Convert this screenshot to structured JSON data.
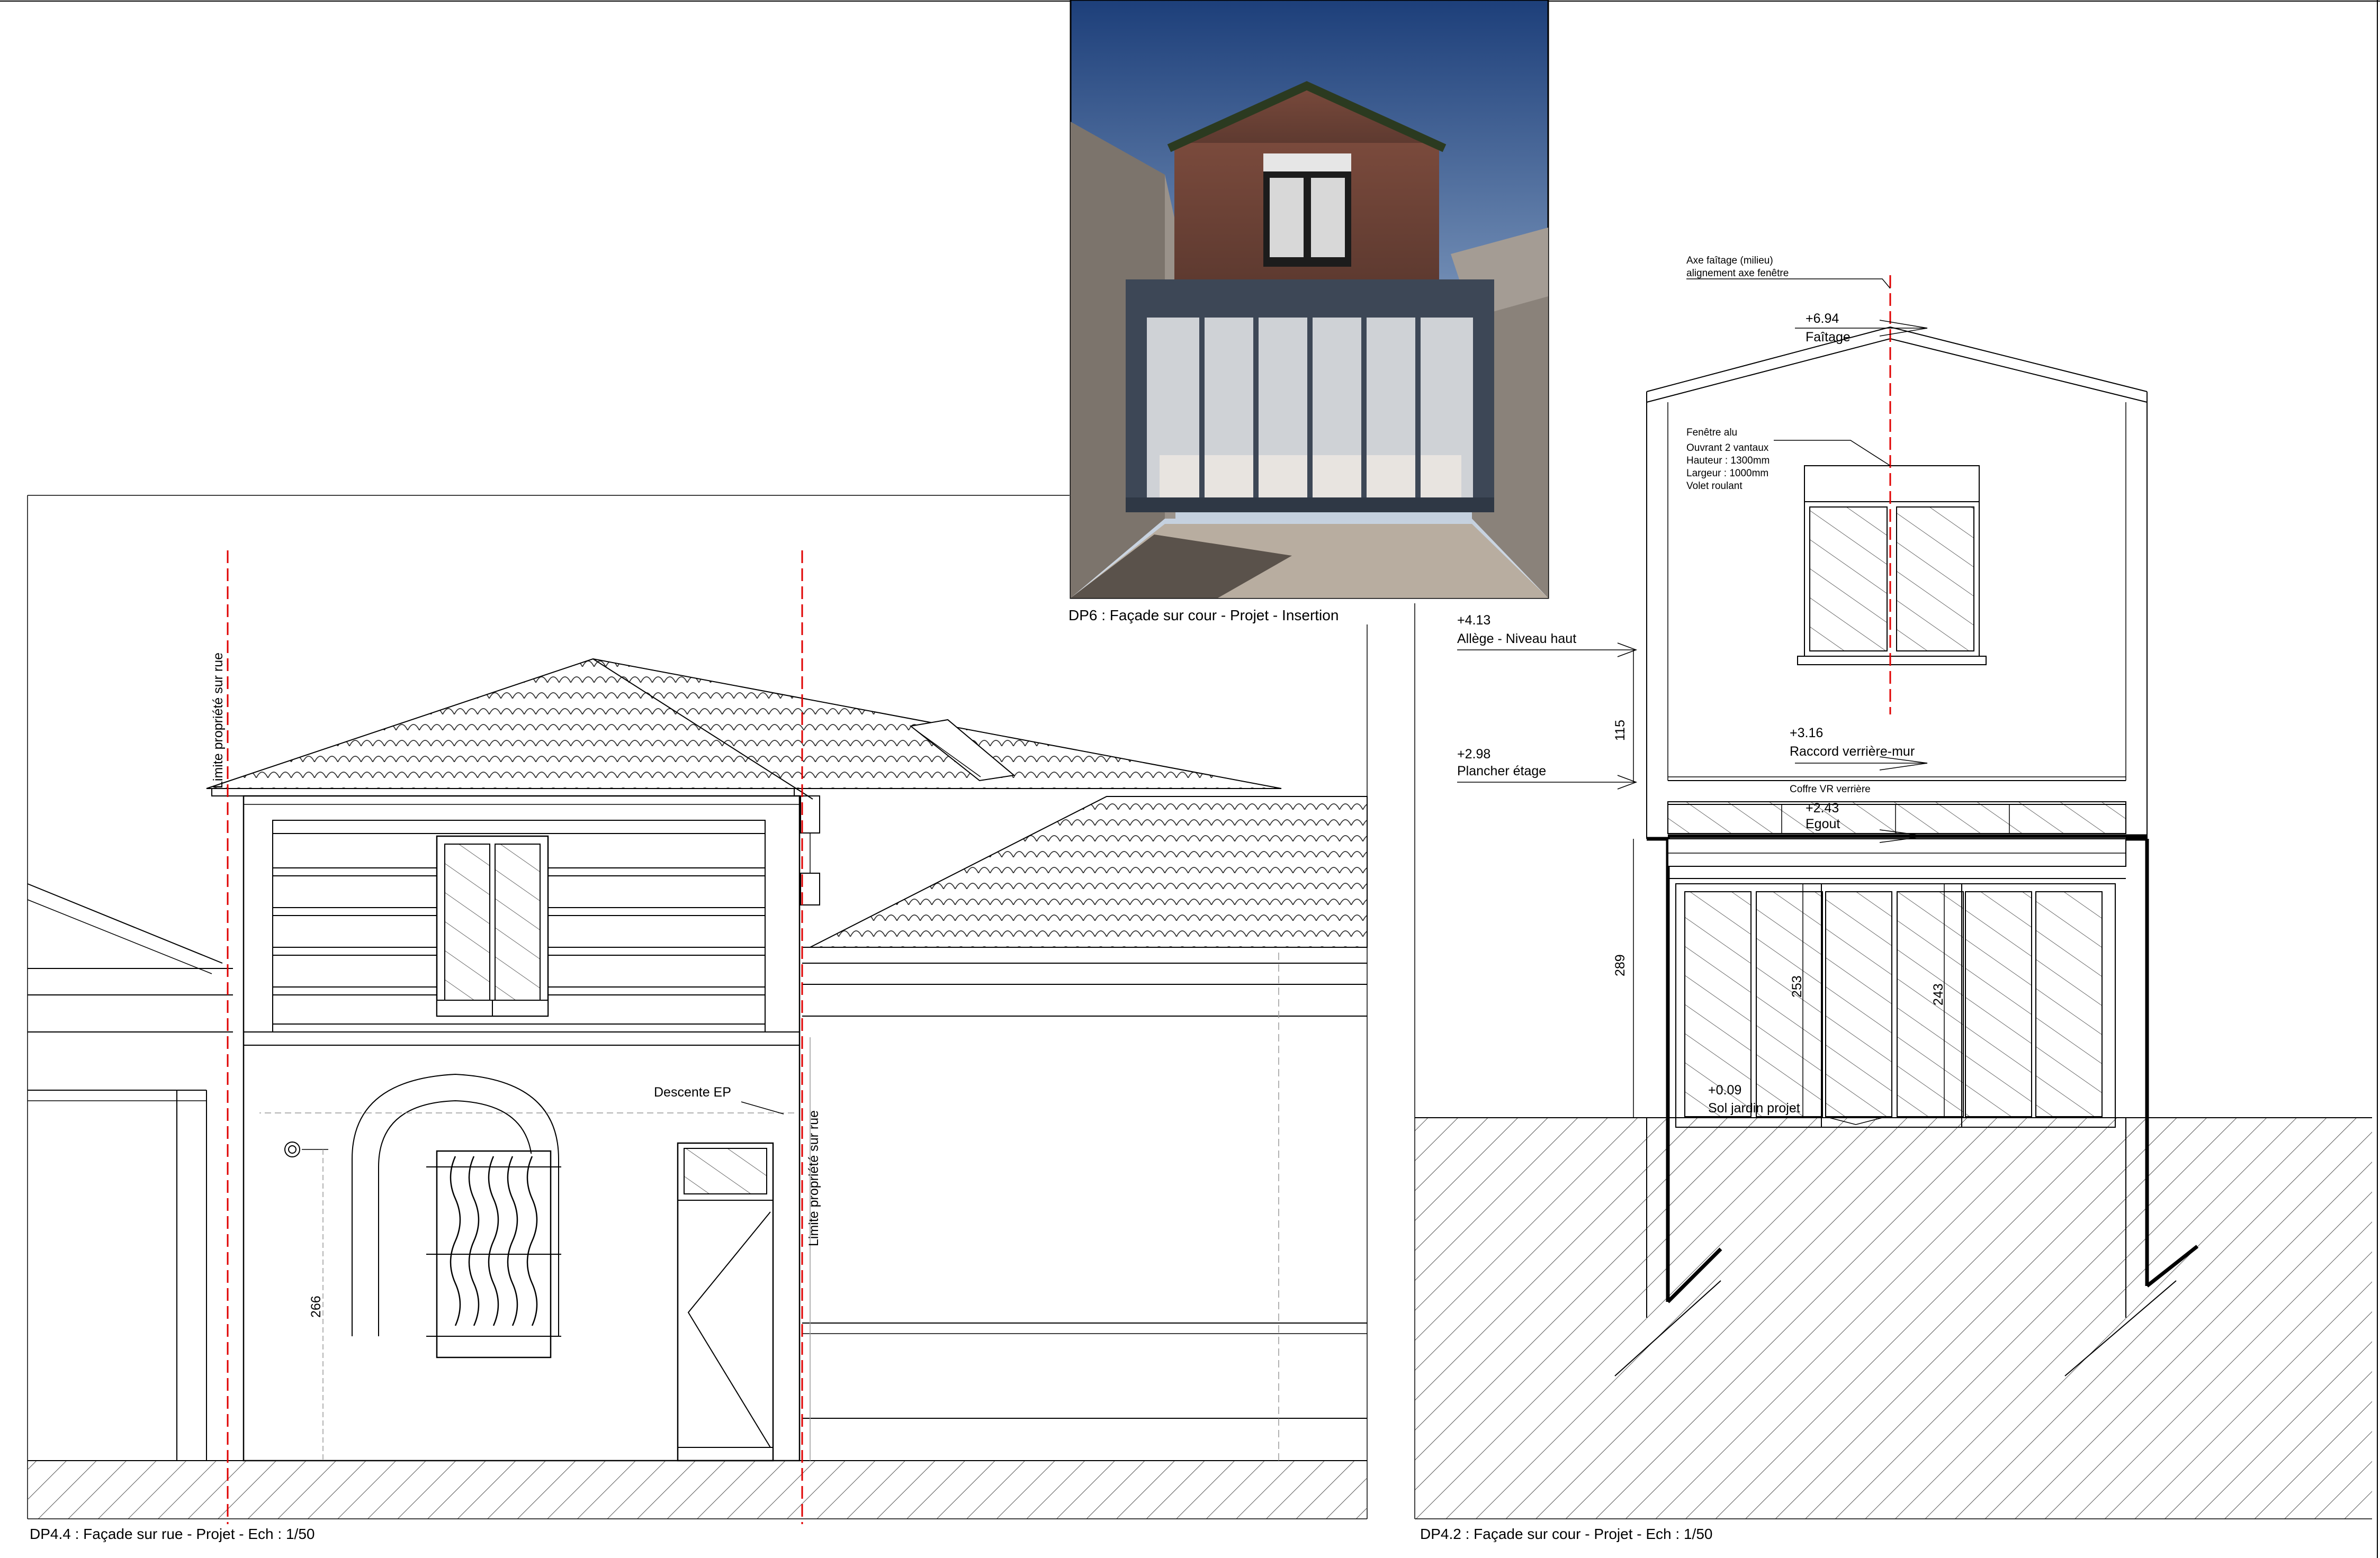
{
  "photo": {
    "caption": "DP6 : Façade sur cour - Projet - Insertion"
  },
  "street_facade": {
    "caption": "DP4.4 : Façade sur rue - Projet - Ech : 1/50",
    "property_limit_left": "Limite propriété sur rue",
    "property_limit_right": "Limite propriété sur rue",
    "downpipe_label": "Descente EP",
    "dim_height": "266"
  },
  "yard_facade": {
    "caption": "DP4.2 : Façade sur cour - Projet - Ech : 1/50",
    "ridge_axis_line1": "Axe faîtage (milieu)",
    "ridge_axis_line2": "alignement axe fenêtre",
    "ridge_level": "+6.94",
    "ridge_label": "Faîtage",
    "window_note": [
      "Fenêtre alu",
      "Ouvrant 2 vantaux",
      "Hauteur : 1300mm",
      "Largeur : 1000mm",
      "Volet roulant"
    ],
    "sill_level": "+4.13",
    "sill_label": "Allège - Niveau haut",
    "dim_115": "115",
    "floor_level": "+2.98",
    "floor_label": "Plancher étage",
    "junction_level": "+3.16",
    "junction_label": "Raccord verrière-mur",
    "box_label": "Coffre VR verrière",
    "eave_level": "+2.43",
    "eave_label": "Egout",
    "dim_289": "289",
    "dim_253": "253",
    "dim_243": "243",
    "garden_level": "+0.09",
    "garden_label": "Sol jardin projet"
  }
}
